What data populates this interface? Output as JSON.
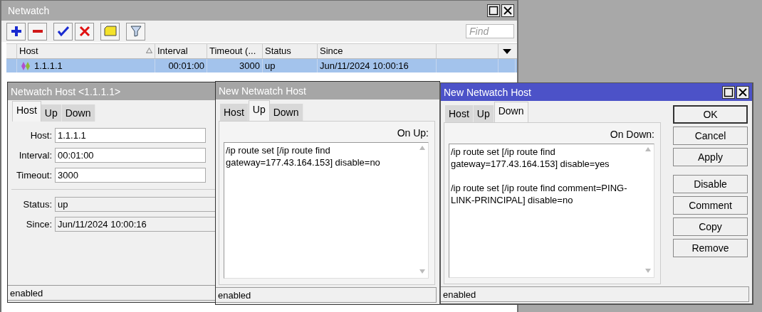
{
  "main_window": {
    "title": "Netwatch",
    "find_placeholder": "Find",
    "columns": [
      "Host",
      "Interval",
      "Timeout (...",
      "Status",
      "Since"
    ],
    "rows": [
      {
        "host": "1.1.1.1",
        "interval": "00:01:00",
        "timeout": "3000",
        "status": "up",
        "since": "Jun/11/2024 10:00:16",
        "selected": true
      }
    ]
  },
  "host_window": {
    "title": "Netwatch Host <1.1.1.1>",
    "active": false,
    "tabs": [
      {
        "label": "Host",
        "selected": true
      },
      {
        "label": "Up",
        "selected": false
      },
      {
        "label": "Down",
        "selected": false
      }
    ],
    "fields": [
      {
        "label": "Host:",
        "value": "1.1.1.1"
      },
      {
        "label": "Interval:",
        "value": "00:01:00"
      },
      {
        "label": "Timeout:",
        "value": "3000"
      }
    ],
    "info_fields": [
      {
        "label": "Status:",
        "value": "up"
      },
      {
        "label": "Since:",
        "value": "Jun/11/2024 10:00:16"
      }
    ],
    "status": "enabled"
  },
  "dialogs": [
    {
      "title": "New Netwatch Host",
      "active": false,
      "tabs": [
        {
          "label": "Host",
          "selected": false
        },
        {
          "label": "Up",
          "selected": true
        },
        {
          "label": "Down",
          "selected": false
        }
      ],
      "script_label": "On Up:",
      "script": [
        "/ip route set [/ip route find gateway=177.43.164.153] disable=no"
      ],
      "status": "enabled"
    },
    {
      "title": "New Netwatch Host",
      "active": true,
      "tabs": [
        {
          "label": "Host",
          "selected": false
        },
        {
          "label": "Up",
          "selected": false
        },
        {
          "label": "Down",
          "selected": true
        }
      ],
      "script_label": "On Down:",
      "script": [
        "/ip route set [/ip route find gateway=177.43.164.153] disable=yes",
        "/ip route set [/ip route find comment=PING-LINK-PRINCIPAL] disable=no"
      ],
      "buttons": [
        {
          "label": "OK",
          "default": true
        },
        {
          "label": "Cancel",
          "default": false
        },
        {
          "label": "Apply",
          "default": false
        },
        {
          "label": "Disable",
          "default": false
        },
        {
          "label": "Comment",
          "default": false
        },
        {
          "label": "Copy",
          "default": false
        },
        {
          "label": "Remove",
          "default": false
        }
      ],
      "status": "enabled"
    }
  ]
}
